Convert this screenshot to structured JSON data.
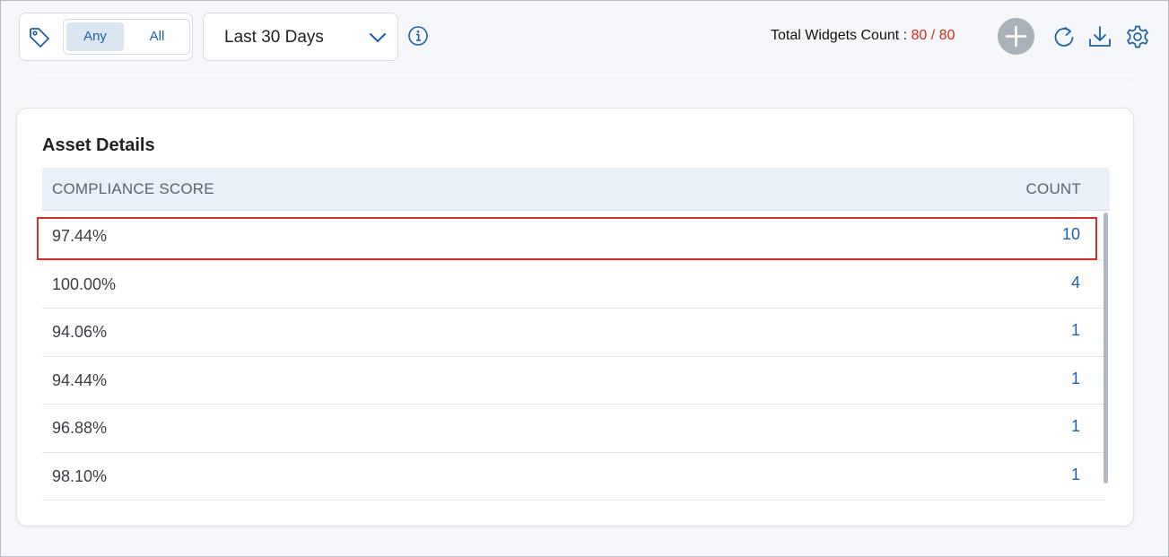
{
  "toolbar": {
    "tag_options": [
      "Any",
      "All"
    ],
    "selected_tag_option": "Any",
    "date_range": "Last 30 Days",
    "widget_count_label": "Total Widgets Count :",
    "widget_count_value": "80 / 80"
  },
  "colors": {
    "accent": "#1f5fa8",
    "count_value": "#d9271c",
    "highlight": "#d32f2f"
  },
  "card": {
    "title": "Asset Details",
    "columns": {
      "score": "COMPLIANCE SCORE",
      "count": "COUNT"
    },
    "rows": [
      {
        "score": "97.44%",
        "count": "10"
      },
      {
        "score": "100.00%",
        "count": "4"
      },
      {
        "score": "94.06%",
        "count": "1"
      },
      {
        "score": "94.44%",
        "count": "1"
      },
      {
        "score": "96.88%",
        "count": "1"
      },
      {
        "score": "98.10%",
        "count": "1"
      }
    ]
  }
}
